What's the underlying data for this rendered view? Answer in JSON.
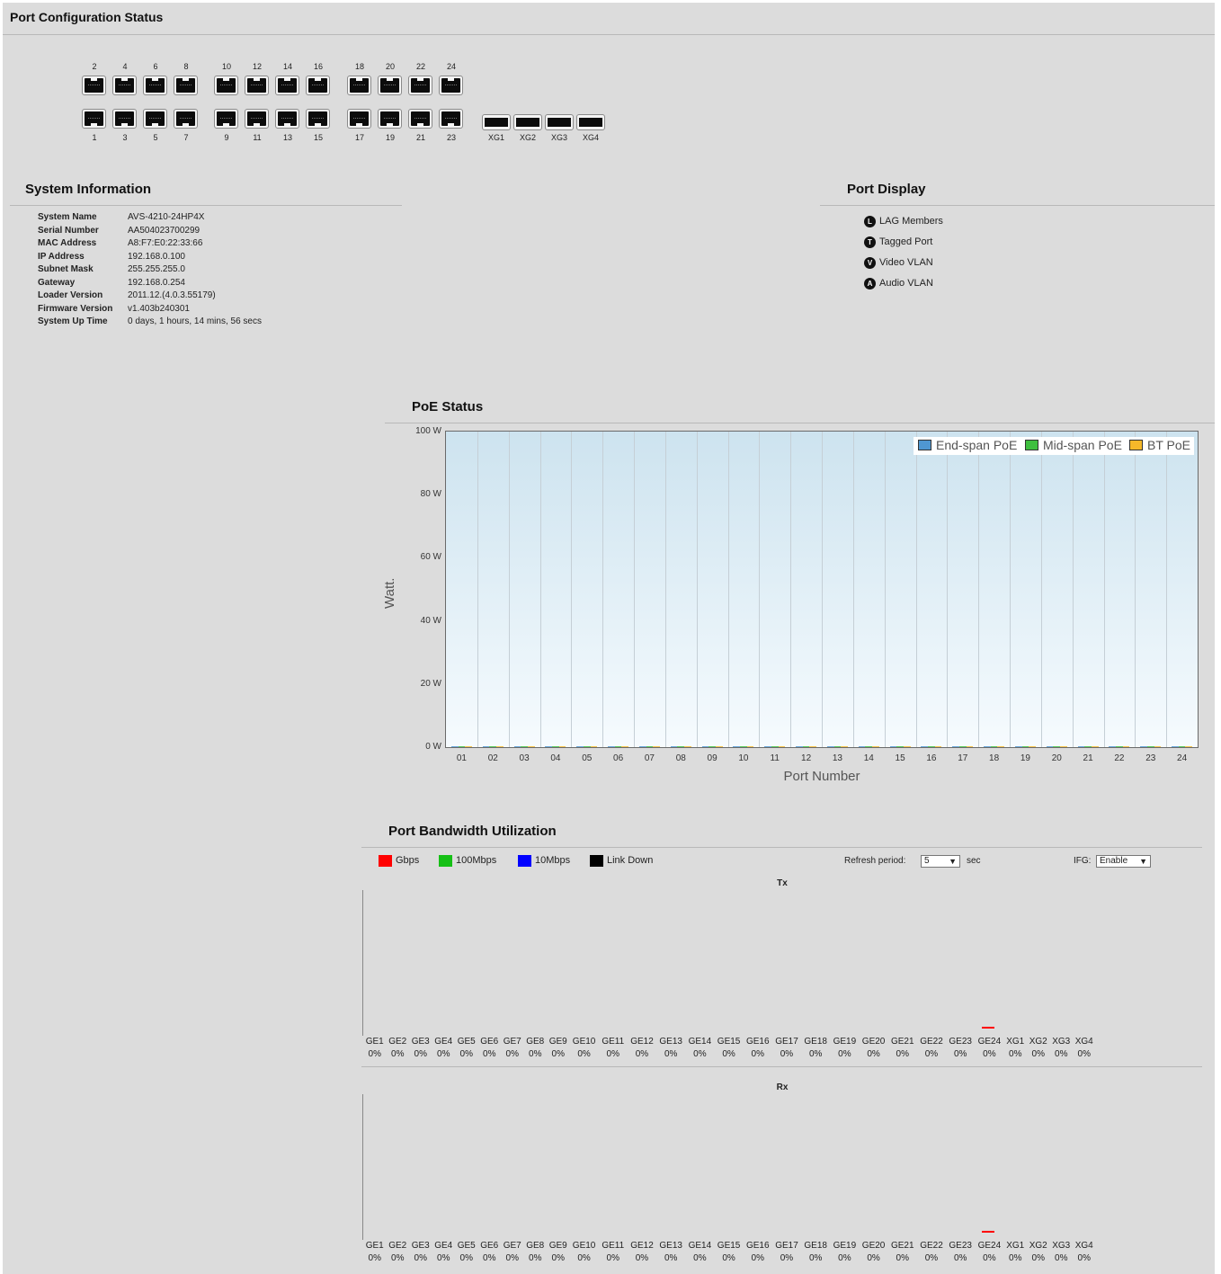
{
  "port_config": {
    "title": "Port Configuration Status",
    "top_ports": [
      "2",
      "4",
      "6",
      "8",
      "10",
      "12",
      "14",
      "16",
      "18",
      "20",
      "22",
      "24"
    ],
    "bottom_ports": [
      "1",
      "3",
      "5",
      "7",
      "9",
      "11",
      "13",
      "15",
      "17",
      "19",
      "21",
      "23"
    ],
    "sfp_ports": [
      "XG1",
      "XG2",
      "XG3",
      "XG4"
    ]
  },
  "system_info": {
    "title": "System Information",
    "rows": [
      {
        "key": "System Name",
        "value": "AVS-4210-24HP4X"
      },
      {
        "key": "Serial Number",
        "value": "AA504023700299"
      },
      {
        "key": "MAC Address",
        "value": "A8:F7:E0:22:33:66"
      },
      {
        "key": "IP Address",
        "value": "192.168.0.100"
      },
      {
        "key": "Subnet Mask",
        "value": "255.255.255.0"
      },
      {
        "key": "Gateway",
        "value": "192.168.0.254"
      },
      {
        "key": "Loader Version",
        "value": "2011.12.(4.0.3.55179)"
      },
      {
        "key": "Firmware Version",
        "value": "v1.403b240301"
      },
      {
        "key": "System Up Time",
        "value": "0 days, 1 hours, 14 mins, 56 secs"
      }
    ]
  },
  "port_display": {
    "title": "Port Display",
    "items": [
      {
        "icon": "L",
        "label": "LAG Members"
      },
      {
        "icon": "T",
        "label": "Tagged Port"
      },
      {
        "icon": "V",
        "label": "Video VLAN"
      },
      {
        "icon": "A",
        "label": "Audio VLAN"
      }
    ]
  },
  "poe_status": {
    "title": "PoE Status",
    "legend": [
      {
        "label": "End-span PoE",
        "color": "#4f97d1"
      },
      {
        "label": "Mid-span PoE",
        "color": "#3fbf3f"
      },
      {
        "label": "BT PoE",
        "color": "#f5b82a"
      }
    ]
  },
  "chart_data": {
    "type": "bar",
    "title": "",
    "xlabel": "Port Number",
    "ylabel": "Watt.",
    "ylim": [
      0,
      100
    ],
    "yticks": [
      "0 W",
      "20 W",
      "40 W",
      "60 W",
      "80 W",
      "100 W"
    ],
    "categories": [
      "01",
      "02",
      "03",
      "04",
      "05",
      "06",
      "07",
      "08",
      "09",
      "10",
      "11",
      "12",
      "13",
      "14",
      "15",
      "16",
      "17",
      "18",
      "19",
      "20",
      "21",
      "22",
      "23",
      "24"
    ],
    "series": [
      {
        "name": "End-span PoE",
        "values": [
          0,
          0,
          0,
          0,
          0,
          0,
          0,
          0,
          0,
          0,
          0,
          0,
          0,
          0,
          0,
          0,
          0,
          0,
          0,
          0,
          0,
          0,
          0,
          0
        ]
      },
      {
        "name": "Mid-span PoE",
        "values": [
          0,
          0,
          0,
          0,
          0,
          0,
          0,
          0,
          0,
          0,
          0,
          0,
          0,
          0,
          0,
          0,
          0,
          0,
          0,
          0,
          0,
          0,
          0,
          0
        ]
      },
      {
        "name": "BT PoE",
        "values": [
          0,
          0,
          0,
          0,
          0,
          0,
          0,
          0,
          0,
          0,
          0,
          0,
          0,
          0,
          0,
          0,
          0,
          0,
          0,
          0,
          0,
          0,
          0,
          0
        ]
      }
    ],
    "legend_position": "top-right",
    "grid": true
  },
  "bandwidth": {
    "title": "Port Bandwidth Utilization",
    "legend": [
      {
        "label": "Gbps",
        "color": "#ff0000"
      },
      {
        "label": "100Mbps",
        "color": "#16c016"
      },
      {
        "label": "10Mbps",
        "color": "#0000ff"
      },
      {
        "label": "Link Down",
        "color": "#000000"
      }
    ],
    "refresh_label": "Refresh period:",
    "refresh_value": "5",
    "refresh_unit": "sec",
    "ifg_label": "IFG:",
    "ifg_value": "Enable",
    "tx_label": "Tx",
    "rx_label": "Rx",
    "ports": [
      "GE1",
      "GE2",
      "GE3",
      "GE4",
      "GE5",
      "GE6",
      "GE7",
      "GE8",
      "GE9",
      "GE10",
      "GE11",
      "GE12",
      "GE13",
      "GE14",
      "GE15",
      "GE16",
      "GE17",
      "GE18",
      "GE19",
      "GE20",
      "GE21",
      "GE22",
      "GE23",
      "GE24",
      "XG1",
      "XG2",
      "XG3",
      "XG4"
    ],
    "tx_values": [
      "0%",
      "0%",
      "0%",
      "0%",
      "0%",
      "0%",
      "0%",
      "0%",
      "0%",
      "0%",
      "0%",
      "0%",
      "0%",
      "0%",
      "0%",
      "0%",
      "0%",
      "0%",
      "0%",
      "0%",
      "0%",
      "0%",
      "0%",
      "0%",
      "0%",
      "0%",
      "0%",
      "0%"
    ],
    "rx_values": [
      "0%",
      "0%",
      "0%",
      "0%",
      "0%",
      "0%",
      "0%",
      "0%",
      "0%",
      "0%",
      "0%",
      "0%",
      "0%",
      "0%",
      "0%",
      "0%",
      "0%",
      "0%",
      "0%",
      "0%",
      "0%",
      "0%",
      "0%",
      "0%",
      "0%",
      "0%",
      "0%",
      "0%"
    ]
  }
}
